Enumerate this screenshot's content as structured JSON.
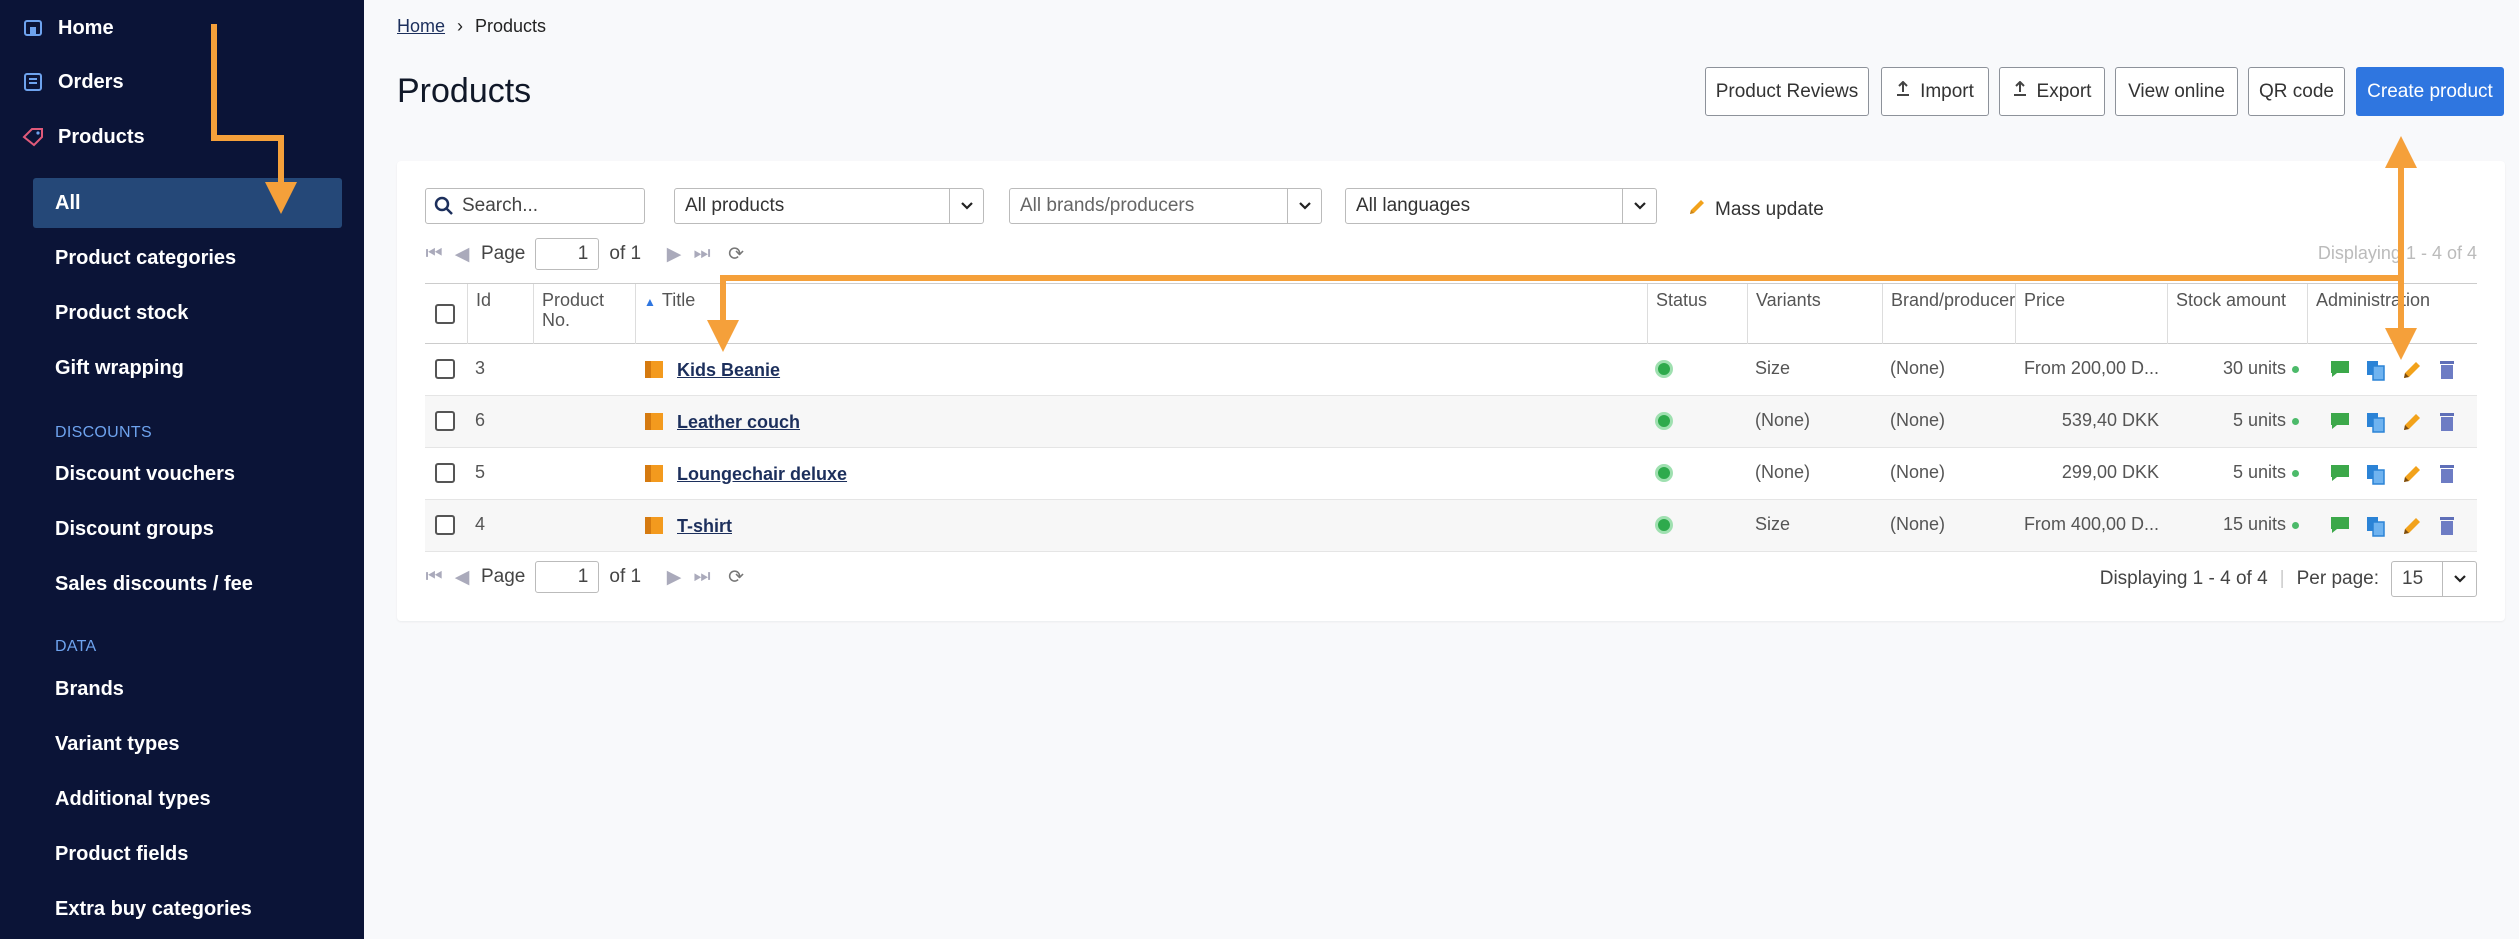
{
  "sidebar": {
    "top_items": [
      {
        "label": "Home",
        "icon": "home-icon"
      },
      {
        "label": "Orders",
        "icon": "orders-icon"
      },
      {
        "label": "Products",
        "icon": "tag-icon"
      }
    ],
    "product_items": [
      "All",
      "Product categories",
      "Product stock",
      "Gift wrapping"
    ],
    "sections": {
      "discounts": {
        "heading": "DISCOUNTS",
        "items": [
          "Discount vouchers",
          "Discount groups",
          "Sales discounts / fee"
        ]
      },
      "data": {
        "heading": "DATA",
        "items": [
          "Brands",
          "Variant types",
          "Additional types",
          "Product fields",
          "Extra buy categories"
        ]
      }
    }
  },
  "breadcrumb": {
    "home": "Home",
    "separator": "›",
    "current": "Products"
  },
  "page": {
    "title": "Products"
  },
  "toolbar": {
    "product_reviews": "Product Reviews",
    "import": "Import",
    "export": "Export",
    "view_online": "View online",
    "qr_code": "QR code",
    "create_product": "Create product"
  },
  "filters": {
    "search_placeholder": "Search...",
    "products_select": "All products",
    "brands_select": "All brands/producers",
    "languages_select": "All languages",
    "mass_update": "Mass update"
  },
  "pager": {
    "page_label": "Page",
    "page_value": "1",
    "of_label": "of 1"
  },
  "display_top": "Displaying 1 - 4 of 4",
  "display_bottom": "Displaying 1 - 4 of 4",
  "per_page": {
    "label": "Per page:",
    "value": "15"
  },
  "table": {
    "headers": {
      "id": "Id",
      "product_no": "Product\nNo.",
      "title": "Title",
      "status": "Status",
      "variants": "Variants",
      "brand": "Brand/producer",
      "price": "Price",
      "stock": "Stock amount",
      "admin": "Administration"
    },
    "rows": [
      {
        "id": "3",
        "title": "Kids Beanie",
        "variants": "Size",
        "brand": "(None)",
        "price": "From 200,00 D...",
        "stock": "30 units"
      },
      {
        "id": "6",
        "title": "Leather couch",
        "variants": "(None)",
        "brand": "(None)",
        "price": "539,40 DKK",
        "stock": "5 units"
      },
      {
        "id": "5",
        "title": "Loungechair deluxe",
        "variants": "(None)",
        "brand": "(None)",
        "price": "299,00 DKK",
        "stock": "5 units"
      },
      {
        "id": "4",
        "title": "T-shirt",
        "variants": "Size",
        "brand": "(None)",
        "price": "From 400,00 D...",
        "stock": "15 units"
      }
    ]
  },
  "colors": {
    "accent": "#2f76e0",
    "sidebar": "#0b1437",
    "annotation_arrow": "#f5a03a"
  }
}
